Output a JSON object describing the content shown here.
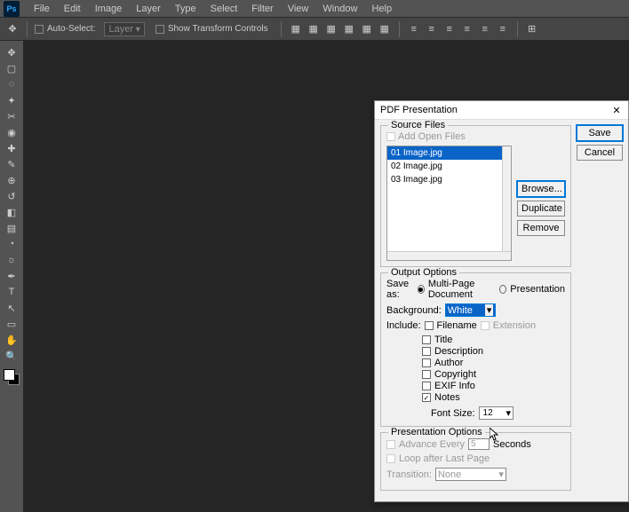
{
  "menu": [
    "File",
    "Edit",
    "Image",
    "Layer",
    "Type",
    "Select",
    "Filter",
    "View",
    "Window",
    "Help"
  ],
  "optbar": {
    "auto_select": "Auto-Select:",
    "layer": "Layer",
    "show_transform": "Show Transform Controls"
  },
  "dialog": {
    "title": "PDF Presentation",
    "close": "✕",
    "save": "Save",
    "cancel": "Cancel",
    "source": {
      "legend": "Source Files",
      "add_open": "Add Open Files",
      "files": [
        "01 Image.jpg",
        "02 Image.jpg",
        "03 Image.jpg"
      ],
      "browse": "Browse...",
      "duplicate": "Duplicate",
      "remove": "Remove"
    },
    "output": {
      "legend": "Output Options",
      "save_as": "Save as:",
      "multi": "Multi-Page Document",
      "pres": "Presentation",
      "bg_label": "Background:",
      "bg_value": "White",
      "include": "Include:",
      "filename": "Filename",
      "extension": "Extension",
      "title": "Title",
      "description": "Description",
      "author": "Author",
      "copyright": "Copyright",
      "exif": "EXIF Info",
      "notes": "Notes",
      "font_size": "Font Size:",
      "font_val": "12"
    },
    "pres_opts": {
      "legend": "Presentation Options",
      "advance": "Advance Every",
      "adv_val": "5",
      "seconds": "Seconds",
      "loop": "Loop after Last Page",
      "transition": "Transition:",
      "trans_val": "None"
    }
  }
}
